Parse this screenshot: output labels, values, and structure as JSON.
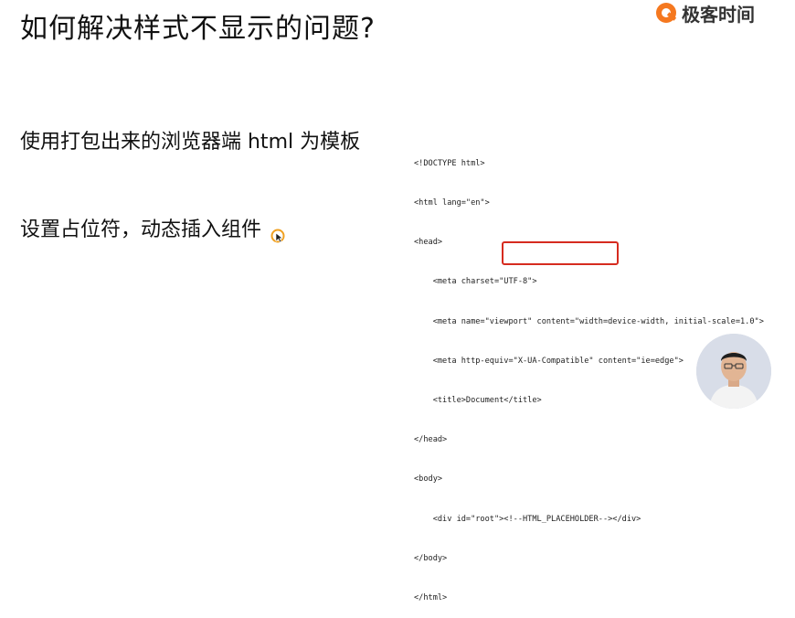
{
  "slide": {
    "title": "如何解决样式不显示的问题?",
    "bullets": [
      "使用打包出来的浏览器端 html 为模板",
      "设置占位符，动态插入组件"
    ]
  },
  "brand": {
    "name": "极客时间",
    "accent_color": "#f5781f"
  },
  "code_lines": [
    "<!DOCTYPE html>",
    "<html lang=\"en\">",
    "<head>",
    "    <meta charset=\"UTF-8\">",
    "    <meta name=\"viewport\" content=\"width=device-width, initial-scale=1.0\">",
    "    <meta http-equiv=\"X-UA-Compatible\" content=\"ie=edge\">",
    "    <title>Document</title>",
    "</head>",
    "<body>",
    "    <div id=\"root\"><!--HTML_PLACEHOLDER--></div>",
    "</body>",
    "</html>"
  ],
  "highlight_color": "#d62b1f"
}
